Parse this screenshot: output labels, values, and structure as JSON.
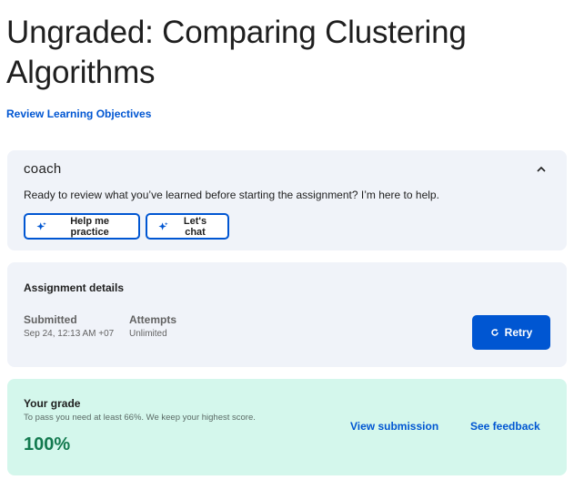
{
  "page": {
    "title": "Ungraded: Comparing Clustering Algorithms",
    "objectives_link": "Review Learning Objectives"
  },
  "coach": {
    "logo": "coach",
    "collapse_icon": "chevron-up-icon",
    "message": "Ready to review what you’ve learned before starting the assignment? I’m here to help.",
    "buttons": [
      {
        "label": "Help me practice",
        "icon": "sparkle-icon"
      },
      {
        "label": "Let's chat",
        "icon": "sparkle-icon"
      }
    ]
  },
  "assignment": {
    "title": "Assignment details",
    "submitted_label": "Submitted",
    "submitted_value": "Sep 24, 12:13 AM +07",
    "attempts_label": "Attempts",
    "attempts_value": "Unlimited",
    "retry_label": "Retry",
    "retry_icon": "refresh-icon"
  },
  "grade": {
    "title": "Your grade",
    "subtitle": "To pass you need at least 66%. We keep your highest score.",
    "value": "100%",
    "view_submission": "View submission",
    "see_feedback": "See feedback"
  },
  "colors": {
    "accent": "#0056d2",
    "card_bg": "#f0f3f9",
    "grade_bg": "#d4f7ec",
    "grade_text": "#137a4f"
  }
}
